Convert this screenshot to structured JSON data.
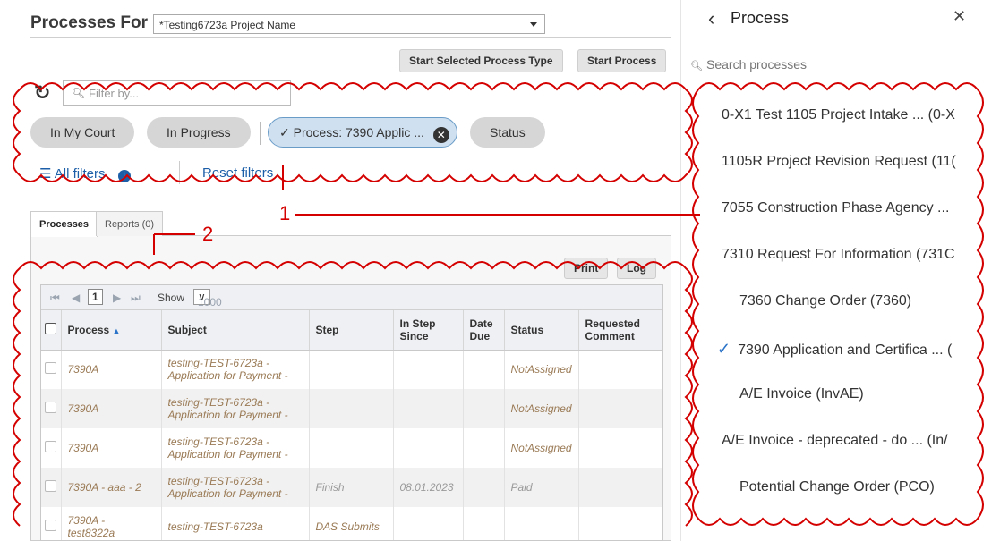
{
  "header": {
    "title": "Processes For",
    "project_value": "*Testing6723a Project Name"
  },
  "toolbar": {
    "start_selected_label": "Start Selected Process Type",
    "start_process_label": "Start Process"
  },
  "filters": {
    "placeholder": "Filter by...",
    "chips": [
      "In My Court",
      "In Progress",
      "Process: 7390 Applic ...",
      "Status"
    ],
    "all_filters_label": "All filters",
    "reset_filters_label": "Reset filters"
  },
  "tabs": [
    "Processes",
    "Reports (0)"
  ],
  "grid_toolbar": {
    "print_label": "Print",
    "log_label": "Log"
  },
  "pager": {
    "page": "1",
    "show_label": "Show",
    "page_size": "1000"
  },
  "table": {
    "columns": [
      "Process",
      "Subject",
      "Step",
      "In Step Since",
      "Date Due",
      "Status",
      "Requested Comment"
    ],
    "rows": [
      {
        "process": "7390A",
        "subject": "testing-TEST-6723a - Application for Payment -",
        "step": "",
        "since": "",
        "due": "",
        "status": "NotAssigned",
        "comment": ""
      },
      {
        "process": "7390A",
        "subject": "testing-TEST-6723a - Application for Payment -",
        "step": "",
        "since": "",
        "due": "",
        "status": "NotAssigned",
        "comment": ""
      },
      {
        "process": "7390A",
        "subject": "testing-TEST-6723a - Application for Payment -",
        "step": "",
        "since": "",
        "due": "",
        "status": "NotAssigned",
        "comment": ""
      },
      {
        "process": "7390A - aaa - 2",
        "subject": "testing-TEST-6723a - Application for Payment -",
        "step": "Finish",
        "since": "08.01.2023",
        "due": "",
        "status": "Paid",
        "comment": ""
      },
      {
        "process": "7390A - test8322a",
        "subject": "testing-TEST-6723a",
        "step": "DAS Submits",
        "since": "",
        "due": "",
        "status": "",
        "comment": ""
      }
    ]
  },
  "process_panel": {
    "title": "Process",
    "search_placeholder": "Search processes",
    "items": [
      {
        "label": "0-X1 Test 1105 Project Intake ... (0-X",
        "indent": 0,
        "checked": false
      },
      {
        "label": "1105R Project Revision Request (11(",
        "indent": 0,
        "checked": false
      },
      {
        "label": "7055 Construction Phase Agency ...",
        "indent": 0,
        "checked": false
      },
      {
        "label": "7310 Request For Information (731C",
        "indent": 0,
        "checked": false
      },
      {
        "label": "7360 Change Order (7360)",
        "indent": 1,
        "checked": false
      },
      {
        "label": "7390 Application and Certifica ... (",
        "indent": 1,
        "checked": true
      },
      {
        "label": "A/E Invoice (InvAE)",
        "indent": 1,
        "checked": false
      },
      {
        "label": "A/E Invoice - deprecated - do ... (In/",
        "indent": 0,
        "checked": false
      },
      {
        "label": "Potential Change Order (PCO)",
        "indent": 1,
        "checked": false
      }
    ]
  },
  "annotations": {
    "callout_1": "1",
    "callout_2": "2",
    "color": "#d40000"
  },
  "colors": {
    "accent": "#1c5fa8",
    "annotation": "#d40000"
  }
}
